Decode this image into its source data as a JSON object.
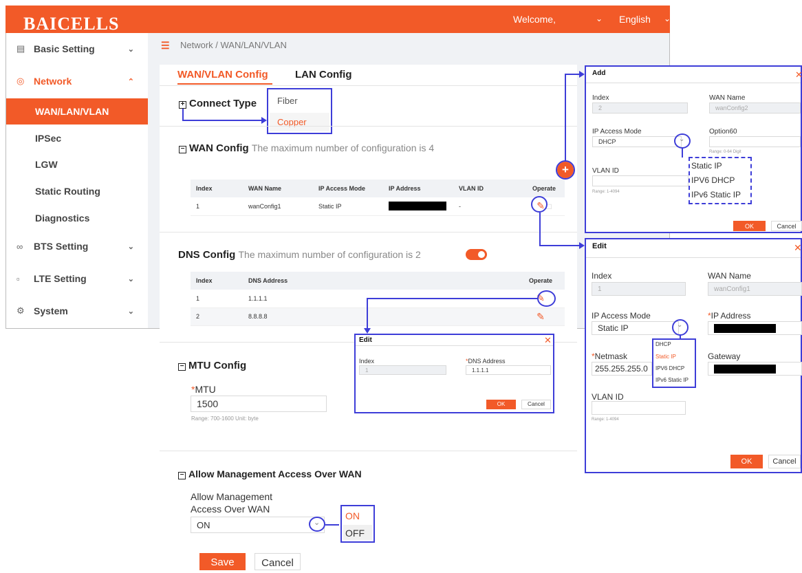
{
  "header": {
    "logo": "BAICELLS",
    "welcome": "Welcome,",
    "language": "English"
  },
  "sidebar": {
    "basic_setting": "Basic Setting",
    "network": "Network",
    "network_sub": [
      "WAN/LAN/VLAN",
      "IPSec",
      "LGW",
      "Static Routing",
      "Diagnostics"
    ],
    "bts_setting": "BTS Setting",
    "lte_setting": "LTE Setting",
    "system": "System"
  },
  "breadcrumb": "Network / WAN/LAN/VLAN",
  "tabs": {
    "active": "WAN/VLAN Config",
    "other": "LAN Config"
  },
  "connect_type": {
    "title": "Connect Type",
    "options": [
      "Fiber",
      "Copper"
    ]
  },
  "wan_config": {
    "title": "WAN Config",
    "note": "The maximum number of configuration is 4",
    "headers": [
      "Index",
      "WAN Name",
      "IP Access Mode",
      "IP Address",
      "VLAN ID",
      "Operate"
    ],
    "rows": [
      {
        "index": "1",
        "name": "wanConfig1",
        "mode": "Static IP",
        "vlan": "-"
      }
    ]
  },
  "dns_config": {
    "title": "DNS Config",
    "note": "The maximum number of configuration is 2",
    "headers": [
      "Index",
      "DNS Address",
      "Operate"
    ],
    "rows": [
      {
        "index": "1",
        "address": "1.1.1.1"
      },
      {
        "index": "2",
        "address": "8.8.8.8"
      }
    ],
    "enabled": true
  },
  "mtu_config": {
    "title": "MTU Config",
    "label": "MTU",
    "value": "1500",
    "hint": "Range: 700-1600 Unit: byte"
  },
  "mgmt_access": {
    "title": "Allow Management Access Over WAN",
    "label1": "Allow Management",
    "label2": "Access Over WAN",
    "value": "ON",
    "options": [
      "ON",
      "OFF"
    ]
  },
  "buttons": {
    "save": "Save",
    "cancel": "Cancel"
  },
  "add_dialog": {
    "title": "Add",
    "index_label": "Index",
    "index_value": "2",
    "wan_name_label": "WAN Name",
    "wan_name_value": "wanConfig2",
    "mode_label": "IP Access Mode",
    "mode_value": "DHCP",
    "option60_label": "Option60",
    "option60_hint": "Range: 0-64 Digit",
    "vlan_label": "VLAN ID",
    "vlan_hint": "Range: 1-4094",
    "mode_options": [
      "Static IP",
      "IPV6 DHCP",
      "IPv6 Static IP"
    ],
    "ok": "OK",
    "cancel": "Cancel"
  },
  "edit_wan_dialog": {
    "title": "Edit",
    "index_label": "Index",
    "index_value": "1",
    "wan_name_label": "WAN Name",
    "wan_name_value": "wanConfig1",
    "mode_label": "IP Access Mode",
    "mode_value": "Static IP",
    "ip_label": "IP Address",
    "netmask_label": "Netmask",
    "netmask_value": "255.255.255.0",
    "gateway_label": "Gateway",
    "vlan_label": "VLAN ID",
    "vlan_hint": "Range: 1-4094",
    "mode_options": [
      "DHCP",
      "Static IP",
      "IPV6 DHCP",
      "IPv6 Static IP"
    ],
    "ok": "OK",
    "cancel": "Cancel"
  },
  "edit_dns_dialog": {
    "title": "Edit",
    "index_label": "Index",
    "index_value": "1",
    "dns_label": "DNS Address",
    "dns_value": "1.1.1.1",
    "ok": "OK",
    "cancel": "Cancel"
  },
  "colors": {
    "accent": "#f25a28",
    "annotation": "#3d3dd8"
  }
}
